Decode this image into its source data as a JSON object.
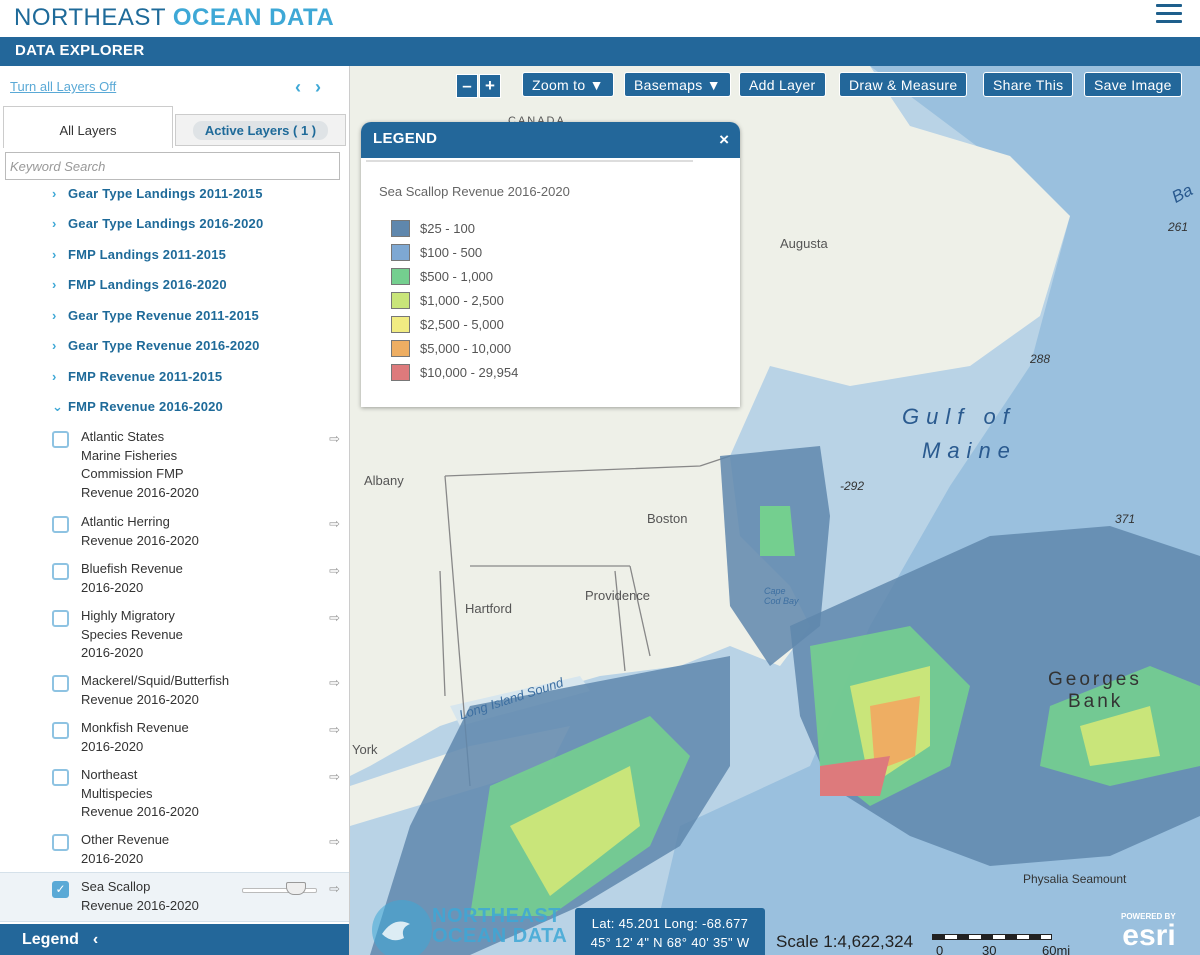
{
  "header": {
    "brand_part1": "NORTHEAST",
    "brand_part2": "OCEAN DATA"
  },
  "explorer": {
    "title": "DATA EXPLORER"
  },
  "sidebar": {
    "turn_off_label": "Turn all Layers Off",
    "tab_all": "All Layers",
    "tab_active": "Active Layers ( 1 )",
    "search_placeholder": "Keyword Search",
    "groups": [
      "Gear Type Landings 2011-2015",
      "Gear Type Landings 2016-2020",
      "FMP Landings 2011-2015",
      "FMP Landings 2016-2020",
      "Gear Type Revenue 2011-2015",
      "Gear Type Revenue 2016-2020",
      "FMP Revenue 2011-2015",
      "FMP Revenue 2016-2020"
    ],
    "items": [
      {
        "lines": [
          "Atlantic States",
          "Marine Fisheries",
          "Commission FMP",
          "Revenue 2016-2020"
        ],
        "checked": false
      },
      {
        "lines": [
          "Atlantic Herring",
          "Revenue 2016-2020"
        ],
        "checked": false
      },
      {
        "lines": [
          "Bluefish Revenue",
          "2016-2020"
        ],
        "checked": false
      },
      {
        "lines": [
          "Highly Migratory",
          "Species Revenue",
          "2016-2020"
        ],
        "checked": false
      },
      {
        "lines": [
          "Mackerel/Squid/Butterfish",
          "Revenue 2016-2020"
        ],
        "checked": false
      },
      {
        "lines": [
          "Monkfish Revenue",
          "2016-2020"
        ],
        "checked": false
      },
      {
        "lines": [
          "Northeast",
          "Multispecies",
          "Revenue 2016-2020"
        ],
        "checked": false
      },
      {
        "lines": [
          "Other Revenue",
          "2016-2020"
        ],
        "checked": false
      },
      {
        "lines": [
          "Sea Scallop",
          "Revenue 2016-2020"
        ],
        "checked": true
      }
    ],
    "legend_label": "Legend"
  },
  "toolbar": {
    "zoom_out": "–",
    "zoom_in": "+",
    "zoom_to": "Zoom to ▼",
    "basemaps": "Basemaps ▼",
    "add_layer": "Add Layer",
    "draw_measure": "Draw & Measure",
    "share": "Share This",
    "save_image": "Save Image"
  },
  "legend": {
    "title": "LEGEND",
    "subtitle": "Sea Scallop Revenue 2016-2020",
    "entries": [
      {
        "label": "$25 - 100",
        "color": "#5f87ad"
      },
      {
        "label": "$100 - 500",
        "color": "#7ea8d3"
      },
      {
        "label": "$500 - 1,000",
        "color": "#74cf8f"
      },
      {
        "label": "$1,000 - 2,500",
        "color": "#c9e57a"
      },
      {
        "label": "$2,500 - 5,000",
        "color": "#f1ec82"
      },
      {
        "label": "$5,000 - 10,000",
        "color": "#eeae63"
      },
      {
        "label": "$10,000 - 29,954",
        "color": "#dd7a7c"
      }
    ]
  },
  "map": {
    "labels": {
      "augusta": "Augusta",
      "albany": "Albany",
      "boston": "Boston",
      "hartford": "Hartford",
      "providence": "Providence",
      "cape_cod_bay": "Cape Cod Bay",
      "long_island_sound": "Long Island Sound",
      "new_york": "York",
      "gulf1": "Gulf of",
      "gulf2": "Maine",
      "georges1": "Georges",
      "georges2": "Bank",
      "physalia": "Physalia Seamount",
      "canada": "CANADA",
      "ba": "Ba",
      "d261": "261",
      "d288": "288",
      "d292": "-292",
      "d371": "371"
    },
    "coords_line1": "Lat: 45.201  Long: -68.677",
    "coords_line2": "45° 12' 4\" N 68° 40' 35\" W",
    "scale_text": "Scale 1:4,622,324",
    "scale_ticks": [
      "0",
      "30",
      "60mi"
    ],
    "logo_text1": "NORTHEAST",
    "logo_text2": "OCEAN DATA",
    "esri_powered": "POWERED BY",
    "esri_text": "esri"
  }
}
